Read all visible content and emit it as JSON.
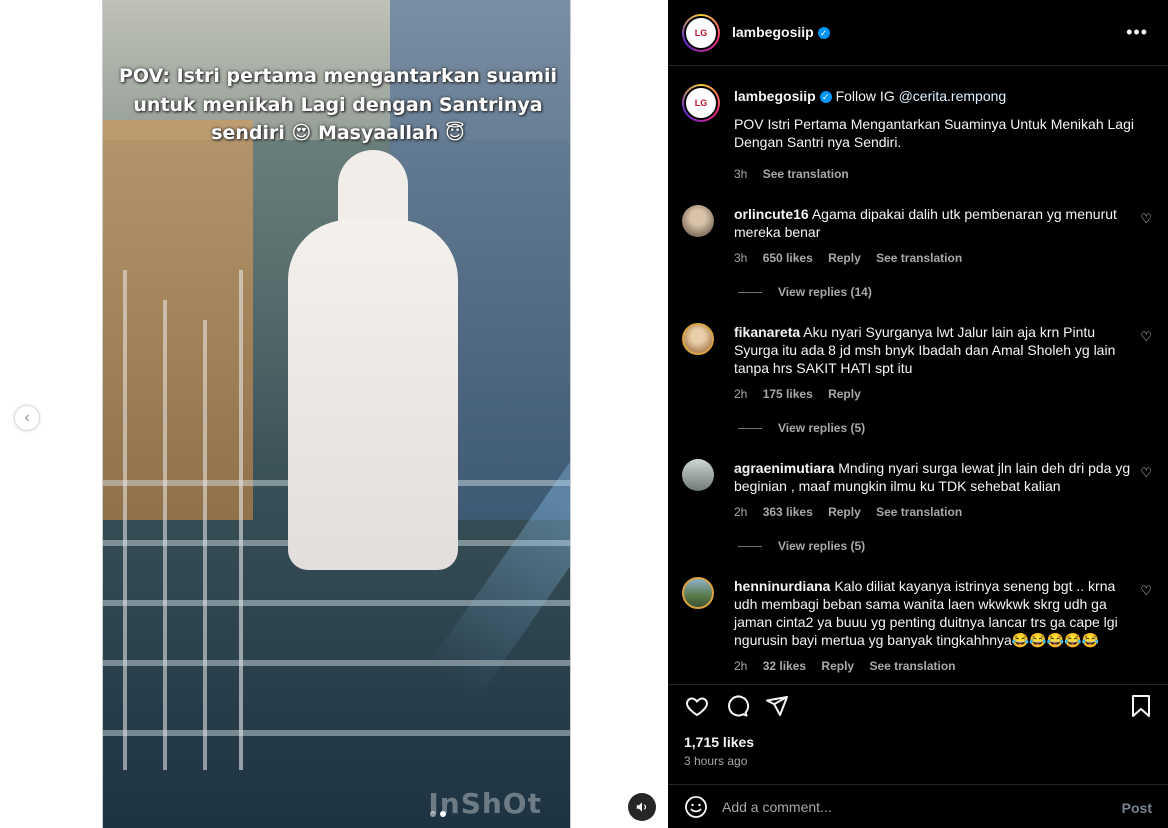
{
  "media": {
    "overlay_text": "POV: Istri pertama mengantarkan suamii untuk menikah Lagi dengan Santrinya sendiri 😍 Masyaallah 😇",
    "watermark": "InShOt",
    "mute_icon": "speaker-icon",
    "prev_icon": "chevron-left-icon"
  },
  "header": {
    "username": "lambegosiip",
    "more_icon": "more-horizontal-icon"
  },
  "caption": {
    "username": "lambegosiip",
    "prefix": "Follow IG",
    "mention": "@cerita.rempong",
    "text": "POV Istri Pertama Mengantarkan Suaminya Untuk Menikah Lagi Dengan Santri nya Sendiri.",
    "time": "3h",
    "see_translation": "See translation"
  },
  "comments": [
    {
      "username": "orlincute16",
      "text": "Agama dipakai dalih utk pembenaran yg menurut mereka benar",
      "time": "3h",
      "likes": "650 likes",
      "reply": "Reply",
      "see_translation": "See translation",
      "view_replies": "View replies (14)"
    },
    {
      "username": "fikanareta",
      "text": "Aku nyari Syurganya lwt Jalur lain aja krn Pintu Syurga itu ada 8 jd msh bnyk Ibadah dan Amal Sholeh yg lain tanpa hrs SAKIT HATI spt itu",
      "time": "2h",
      "likes": "175 likes",
      "reply": "Reply",
      "view_replies": "View replies (5)"
    },
    {
      "username": "agraenimutiara",
      "text": "Mnding nyari surga lewat jln lain deh dri pda yg beginian , maaf mungkin ilmu ku TDK sehebat kalian",
      "time": "2h",
      "likes": "363 likes",
      "reply": "Reply",
      "see_translation": "See translation",
      "view_replies": "View replies (5)"
    },
    {
      "username": "henninurdiana",
      "text": "Kalo diliat kayanya istrinya seneng bgt .. krna udh membagi beban sama wanita laen wkwkwk skrg udh ga jaman cinta2 ya buuu yg penting duitnya lancar trs ga cape lgi ngurusin bayi mertua yg banyak tingkahhnya😂😂😂😂😂",
      "time": "2h",
      "likes": "32 likes",
      "reply": "Reply",
      "see_translation": "See translation"
    }
  ],
  "actions": {
    "likes": "1,715 likes",
    "time_ago": "3 hours ago",
    "icons": [
      "heart-icon",
      "comment-icon",
      "share-icon",
      "bookmark-icon"
    ]
  },
  "add_comment": {
    "placeholder": "Add a comment...",
    "post_label": "Post",
    "emoji_icon": "emoji-icon"
  },
  "colors": {
    "background": "#000000",
    "verified": "#0095f6",
    "mention": "#e0f1ff",
    "secondary_text": "#a8a8a8"
  }
}
